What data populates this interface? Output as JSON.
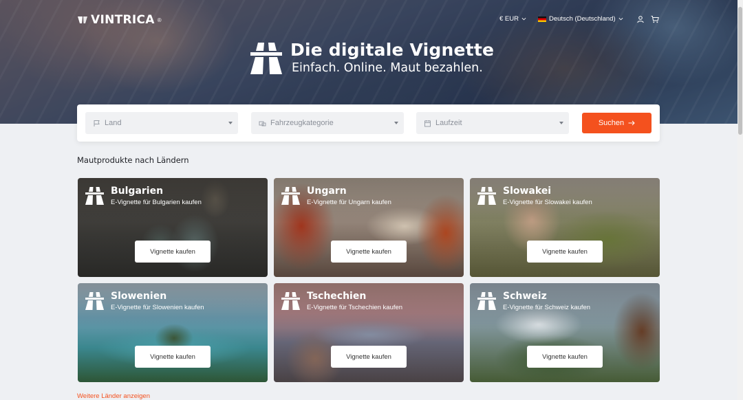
{
  "header": {
    "logo_text": "VINTRICA",
    "logo_reg": "®",
    "currency": "€ EUR",
    "language": "Deutsch (Deutschland)"
  },
  "hero": {
    "title": "Die digitale Vignette",
    "subtitle": "Einfach. Online. Maut bezahlen."
  },
  "search": {
    "land_placeholder": "Land",
    "category_placeholder": "Fahrzeugkategorie",
    "duration_placeholder": "Laufzeit",
    "button_label": "Suchen"
  },
  "section": {
    "title": "Mautprodukte nach Ländern"
  },
  "cards": [
    {
      "name": "Bulgarien",
      "subtitle": "E-Vignette für Bulgarien kaufen",
      "button": "Vignette kaufen"
    },
    {
      "name": "Ungarn",
      "subtitle": "E-Vignette für Ungarn kaufen",
      "button": "Vignette kaufen"
    },
    {
      "name": "Slowakei",
      "subtitle": "E-Vignette für Slowakei kaufen",
      "button": "Vignette kaufen"
    },
    {
      "name": "Slowenien",
      "subtitle": "E-Vignette für Slowenien kaufen",
      "button": "Vignette kaufen"
    },
    {
      "name": "Tschechien",
      "subtitle": "E-Vignette für Tschechien kaufen",
      "button": "Vignette kaufen"
    },
    {
      "name": "Schweiz",
      "subtitle": "E-Vignette für Schweiz kaufen",
      "button": "Vignette kaufen"
    }
  ],
  "more_link": "Weitere Länder anzeigen",
  "colors": {
    "accent": "#f4511e",
    "background": "#eef0f3"
  }
}
